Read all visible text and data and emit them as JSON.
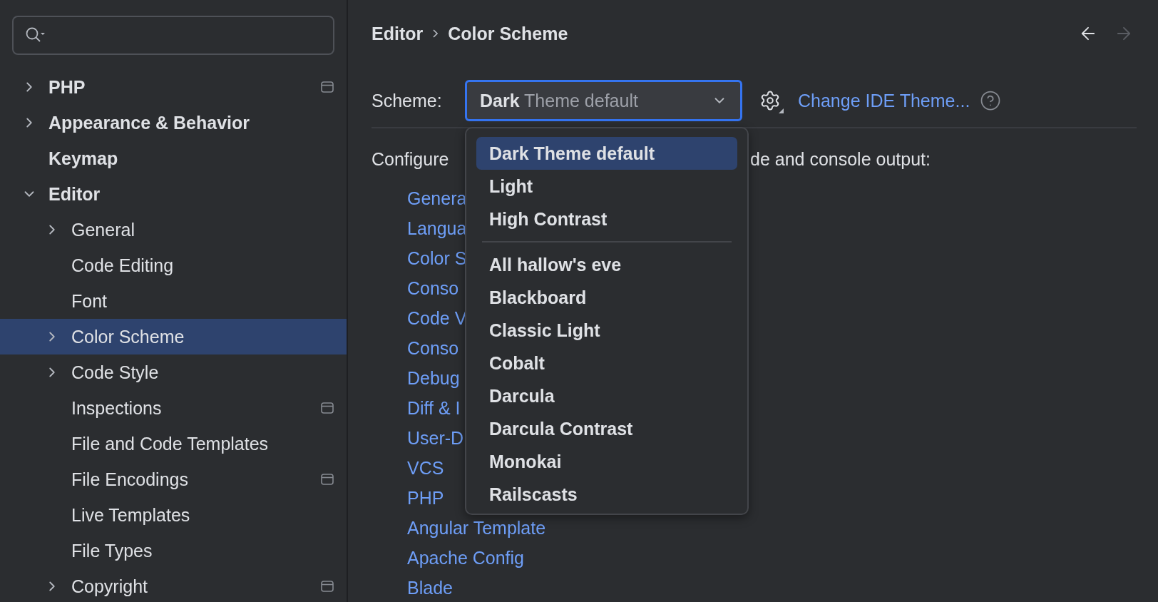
{
  "sidebar": {
    "items": [
      {
        "label": "PHP",
        "expanded": false,
        "selected": false,
        "badge": true
      },
      {
        "label": "Appearance & Behavior",
        "expanded": false,
        "selected": false,
        "badge": false
      },
      {
        "label": "Keymap",
        "selected": false,
        "badge": false
      },
      {
        "label": "Editor",
        "expanded": true,
        "selected": false,
        "badge": false,
        "children": [
          {
            "label": "General",
            "expanded": false,
            "selected": false,
            "badge": false
          },
          {
            "label": "Code Editing",
            "selected": false,
            "badge": false
          },
          {
            "label": "Font",
            "selected": false,
            "badge": false
          },
          {
            "label": "Color Scheme",
            "expanded": false,
            "selected": true,
            "badge": false
          },
          {
            "label": "Code Style",
            "expanded": false,
            "selected": false,
            "badge": false
          },
          {
            "label": "Inspections",
            "selected": false,
            "badge": true
          },
          {
            "label": "File and Code Templates",
            "selected": false,
            "badge": false
          },
          {
            "label": "File Encodings",
            "selected": false,
            "badge": true
          },
          {
            "label": "Live Templates",
            "selected": false,
            "badge": false
          },
          {
            "label": "File Types",
            "selected": false,
            "badge": false
          },
          {
            "label": "Copyright",
            "expanded": false,
            "selected": false,
            "badge": true
          }
        ]
      }
    ]
  },
  "breadcrumb": [
    "Editor",
    "Color Scheme"
  ],
  "navigation": {
    "back_enabled": true,
    "forward_enabled": false
  },
  "scheme": {
    "label": "Scheme:",
    "value": "**Dark** Theme default",
    "focused": true,
    "link": "Change IDE Theme..."
  },
  "description": [
    "Configure",
    "de and console output:"
  ],
  "categories": [
    "Genera",
    "Langua",
    "Color S",
    "Conso",
    "Code V",
    "Conso",
    "Debug",
    "Diff & I",
    "User-D",
    "VCS",
    "PHP",
    "Angular Template",
    "Apache Config",
    "Blade"
  ],
  "dropdown": {
    "groups": [
      [
        {
          "label": "Dark Theme default",
          "selected": true
        },
        {
          "label": "Light",
          "selected": false
        },
        {
          "label": "High Contrast",
          "selected": false
        }
      ],
      [
        {
          "label": "All hallow's eve",
          "selected": false
        },
        {
          "label": "Blackboard",
          "selected": false
        },
        {
          "label": "Classic Light",
          "selected": false
        },
        {
          "label": "Cobalt",
          "selected": false
        },
        {
          "label": "Darcula",
          "selected": false
        },
        {
          "label": "Darcula Contrast",
          "selected": false
        },
        {
          "label": "Monokai",
          "selected": false
        },
        {
          "label": "Railscasts",
          "selected": false
        }
      ]
    ]
  }
}
